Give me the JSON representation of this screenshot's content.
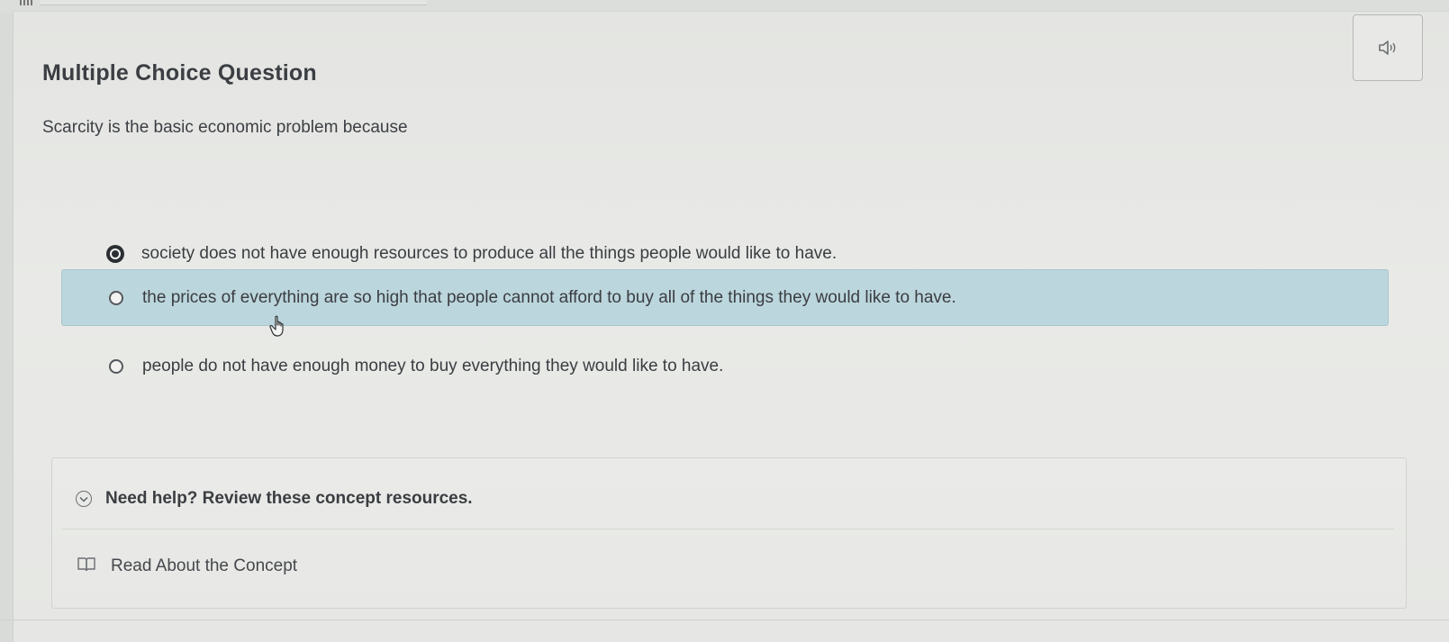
{
  "question": {
    "type_label": "Multiple Choice Question",
    "prompt": "Scarcity is the basic economic problem because",
    "options": [
      {
        "text": "society does not have enough resources to produce all the things people would like to have.",
        "selected": true,
        "hovered": false
      },
      {
        "text": "the prices of everything are so high that people cannot afford to buy all of the things they would like to have.",
        "selected": false,
        "hovered": true
      },
      {
        "text": "people do not have enough money to buy everything they would like to have.",
        "selected": false,
        "hovered": false
      }
    ]
  },
  "audio": {
    "icon": "speaker-icon"
  },
  "help": {
    "toggle_label": "Need help? Review these concept resources.",
    "toggle_icon": "chevron-down-circle-icon",
    "resources": [
      {
        "label": "Read About the Concept",
        "icon": "book-icon"
      }
    ]
  },
  "colors": {
    "selected_row_bg": "#bcd6dd",
    "text": "#3a3d41",
    "background": "#e6e7e4"
  }
}
